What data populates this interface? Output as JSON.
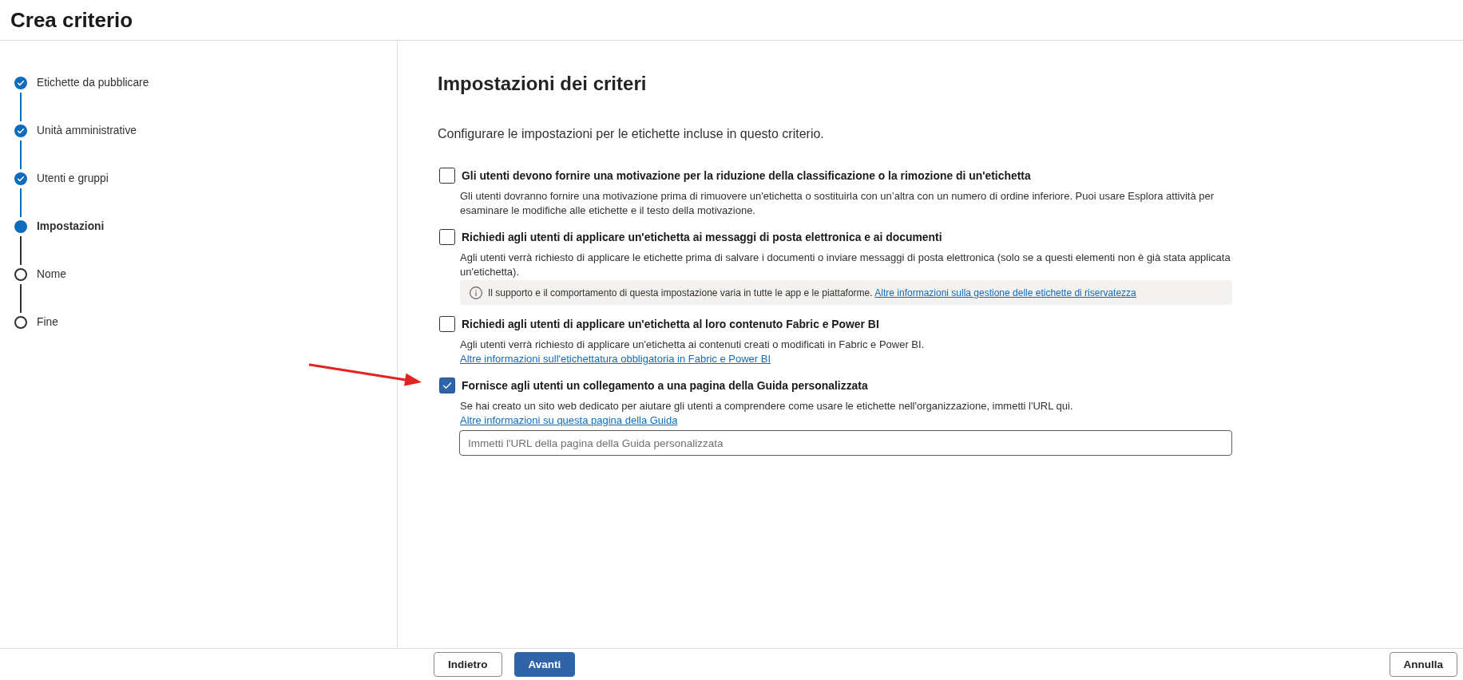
{
  "page": {
    "title": "Crea criterio"
  },
  "steps": [
    {
      "label": "Etichette da pubblicare",
      "completed": true,
      "selected": false
    },
    {
      "label": "Unità amministrative",
      "completed": true,
      "selected": false
    },
    {
      "label": "Utenti e gruppi",
      "completed": true,
      "selected": false
    },
    {
      "label": "Impostazioni",
      "completed": false,
      "selected": true
    },
    {
      "label": "Nome",
      "completed": false,
      "selected": false
    },
    {
      "label": "Fine",
      "completed": false,
      "selected": false
    }
  ],
  "settings": {
    "title": "Impostazioni dei criteri",
    "description": "Configurare le impostazioni per le etichette incluse in questo criterio.",
    "options": [
      {
        "label": "Gli utenti devono fornire una motivazione per la riduzione della classificazione o la rimozione di un'etichetta",
        "checked": false,
        "description": "Gli utenti dovranno fornire una motivazione prima di rimuovere un'etichetta o sostituirla con un’altra con un numero di ordine inferiore. Puoi usare Esplora attività per esaminare le modifiche alle etichette e il testo della motivazione."
      },
      {
        "label": "Richiedi agli utenti di applicare un'etichetta ai messaggi di posta elettronica e ai documenti",
        "checked": false,
        "description": "Agli utenti verrà richiesto di applicare le etichette prima di salvare i documenti o inviare messaggi di posta elettronica (solo se a questi elementi non è già stata applicata un'etichetta).",
        "info": {
          "text": "Il supporto e il comportamento di questa impostazione varia in tutte le app e le piattaforme.",
          "link": "Altre informazioni sulla gestione delle etichette di riservatezza"
        }
      },
      {
        "label": "Richiedi agli utenti di applicare un'etichetta al loro contenuto Fabric e Power BI",
        "checked": false,
        "description": "Agli utenti verrà richiesto di applicare un'etichetta ai contenuti creati o modificati in Fabric e Power BI.",
        "link": "Altre informazioni sull'etichettatura obbligatoria in Fabric e Power BI"
      },
      {
        "label": "Fornisce agli utenti un collegamento a una pagina della Guida personalizzata",
        "checked": true,
        "description": "Se hai creato un sito web dedicato per aiutare gli utenti a comprendere come usare le etichette nell'organizzazione, immetti l'URL qui.",
        "link": "Altre informazioni su questa pagina della Guida",
        "input": {
          "placeholder": "Immetti l'URL della pagina della Guida personalizzata"
        }
      }
    ]
  },
  "annotation": {
    "kind": "arrow"
  },
  "footer": {
    "buttons": [
      {
        "label": "Indietro",
        "kind": "secondary"
      },
      {
        "label": "Avanti",
        "kind": "primary"
      }
    ],
    "cancel": {
      "label": "Annulla"
    }
  }
}
